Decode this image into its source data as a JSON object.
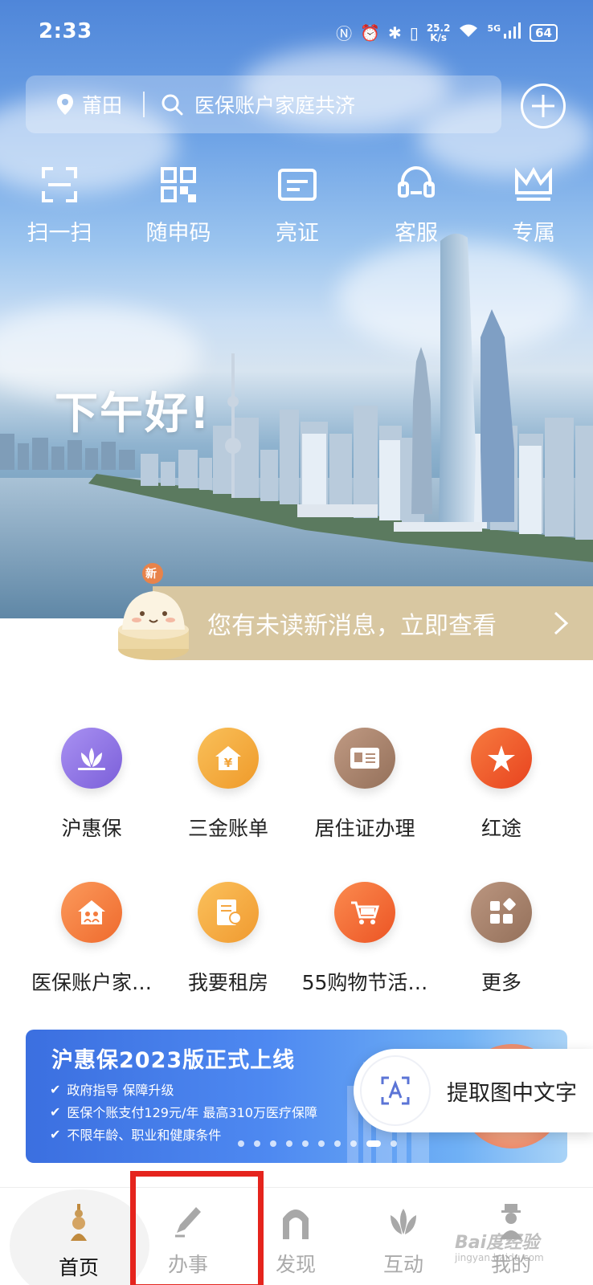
{
  "status_bar": {
    "time": "2:33",
    "speed_value": "25.2",
    "speed_unit": "K/s",
    "network": "5G",
    "battery": "64"
  },
  "search": {
    "city": "莆田",
    "placeholder": "医保账户家庭共济"
  },
  "quick_actions": [
    {
      "label": "扫一扫",
      "icon": "scan-icon"
    },
    {
      "label": "随申码",
      "icon": "qrcode-icon"
    },
    {
      "label": "亮证",
      "icon": "id-card-icon"
    },
    {
      "label": "客服",
      "icon": "headset-icon"
    },
    {
      "label": "专属",
      "icon": "crown-icon"
    }
  ],
  "greeting": "下午好!",
  "notification": {
    "badge": "新",
    "text": "您有未读新消息，立即查看"
  },
  "services": [
    {
      "label": "沪惠保",
      "icon": "lotus-icon",
      "color": "#8a6fe0"
    },
    {
      "label": "三金账单",
      "icon": "yuan-house-icon",
      "color": "#f2a43a"
    },
    {
      "label": "居住证办理",
      "icon": "residence-card-icon",
      "color": "#a8816a"
    },
    {
      "label": "红途",
      "icon": "red-star-icon",
      "color": "#ef5a2c"
    },
    {
      "label": "医保账户家…",
      "icon": "family-house-icon",
      "color": "#f47c3e"
    },
    {
      "label": "我要租房",
      "icon": "rent-document-icon",
      "color": "#f5a640"
    },
    {
      "label": "55购物节活…",
      "icon": "shopping-cart-icon",
      "color": "#f26a35"
    },
    {
      "label": "更多",
      "icon": "more-grid-icon",
      "color": "#a37f69"
    }
  ],
  "banner": {
    "title": "沪惠保2023版正式上线",
    "lines": [
      "政府指导 保障升级",
      "医保个账支付129元/年 最高310万医疗保障",
      "不限年龄、职业和健康条件"
    ]
  },
  "extract_text_button": "提取图中文字",
  "tabs": [
    {
      "label": "首页",
      "icon": "pagoda-icon",
      "active": true
    },
    {
      "label": "办事",
      "icon": "pen-icon",
      "active": false
    },
    {
      "label": "发现",
      "icon": "arch-icon",
      "active": false
    },
    {
      "label": "互动",
      "icon": "magnolia-icon",
      "active": false
    },
    {
      "label": "我的",
      "icon": "person-icon",
      "active": false
    }
  ],
  "watermark": {
    "text": "Bai度经验",
    "sub": "jingyan.baidu.com"
  }
}
